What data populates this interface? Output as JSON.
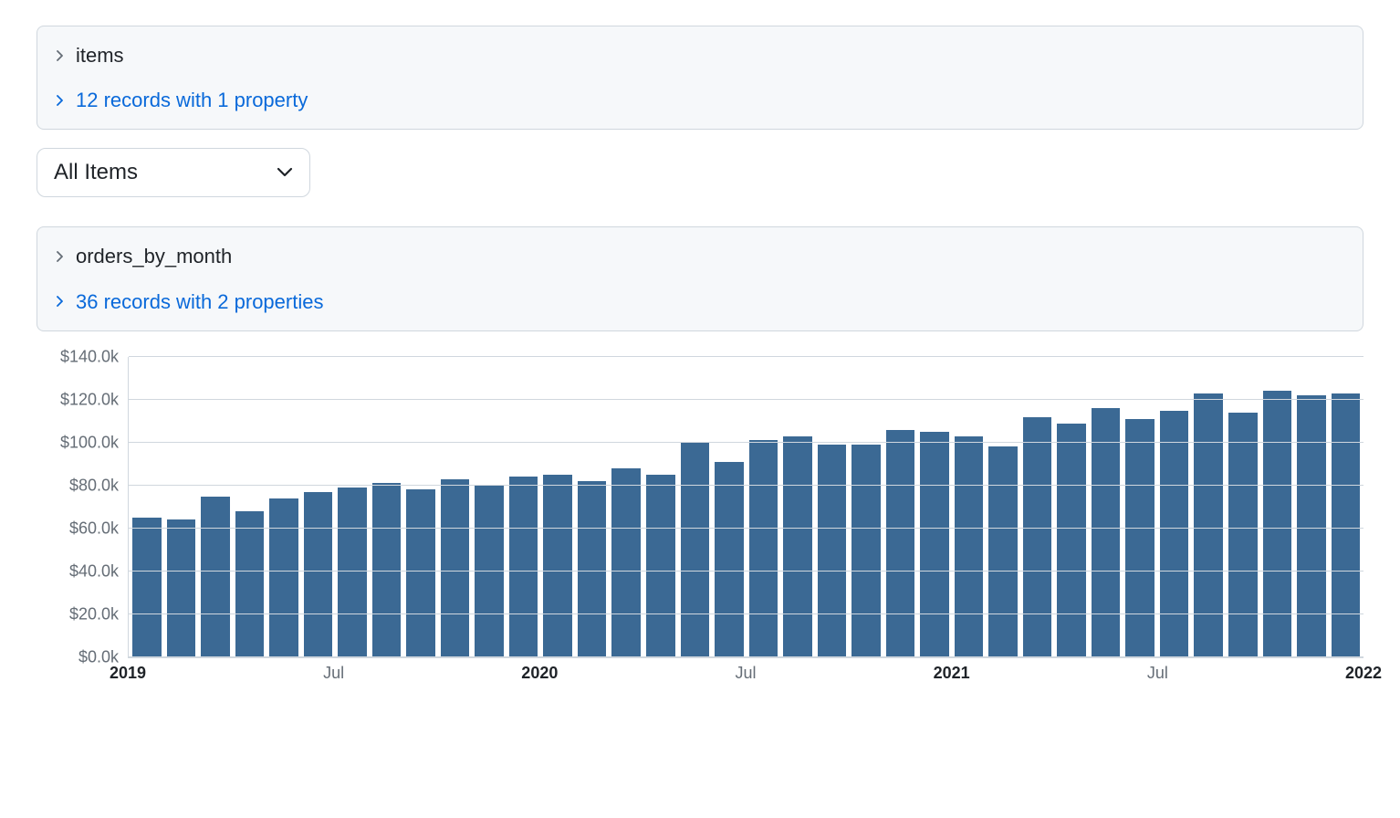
{
  "panel_items": {
    "title": "items",
    "link": "12 records with 1 property"
  },
  "filter": {
    "selected": "All Items"
  },
  "panel_orders": {
    "title": "orders_by_month",
    "link": "36 records with 2 properties"
  },
  "chart_data": {
    "type": "bar",
    "ylabel": "",
    "xlabel": "",
    "ylim": [
      0,
      140000
    ],
    "y_ticks": [
      {
        "v": 0,
        "label": "$0.0k"
      },
      {
        "v": 20000,
        "label": "$20.0k"
      },
      {
        "v": 40000,
        "label": "$40.0k"
      },
      {
        "v": 60000,
        "label": "$60.0k"
      },
      {
        "v": 80000,
        "label": "$80.0k"
      },
      {
        "v": 100000,
        "label": "$100.0k"
      },
      {
        "v": 120000,
        "label": "$120.0k"
      },
      {
        "v": 140000,
        "label": "$140.0k"
      }
    ],
    "x_ticks": [
      {
        "i": 0,
        "label": "2019",
        "bold": true
      },
      {
        "i": 6,
        "label": "Jul",
        "bold": false
      },
      {
        "i": 12,
        "label": "2020",
        "bold": true
      },
      {
        "i": 18,
        "label": "Jul",
        "bold": false
      },
      {
        "i": 24,
        "label": "2021",
        "bold": true
      },
      {
        "i": 30,
        "label": "Jul",
        "bold": false
      },
      {
        "i": 36,
        "label": "2022",
        "bold": true
      }
    ],
    "categories": [
      "2019-01",
      "2019-02",
      "2019-03",
      "2019-04",
      "2019-05",
      "2019-06",
      "2019-07",
      "2019-08",
      "2019-09",
      "2019-10",
      "2019-11",
      "2019-12",
      "2020-01",
      "2020-02",
      "2020-03",
      "2020-04",
      "2020-05",
      "2020-06",
      "2020-07",
      "2020-08",
      "2020-09",
      "2020-10",
      "2020-11",
      "2020-12",
      "2021-01",
      "2021-02",
      "2021-03",
      "2021-04",
      "2021-05",
      "2021-06",
      "2021-07",
      "2021-08",
      "2021-09",
      "2021-10",
      "2021-11",
      "2021-12"
    ],
    "values": [
      65000,
      64000,
      75000,
      68000,
      74000,
      77000,
      79000,
      81000,
      78000,
      83000,
      80000,
      84000,
      85000,
      82000,
      88000,
      85000,
      100000,
      91000,
      101000,
      103000,
      99000,
      99000,
      106000,
      105000,
      103000,
      98000,
      112000,
      109000,
      116000,
      111000,
      115000,
      123000,
      114000,
      124000,
      122000,
      123000
    ]
  }
}
